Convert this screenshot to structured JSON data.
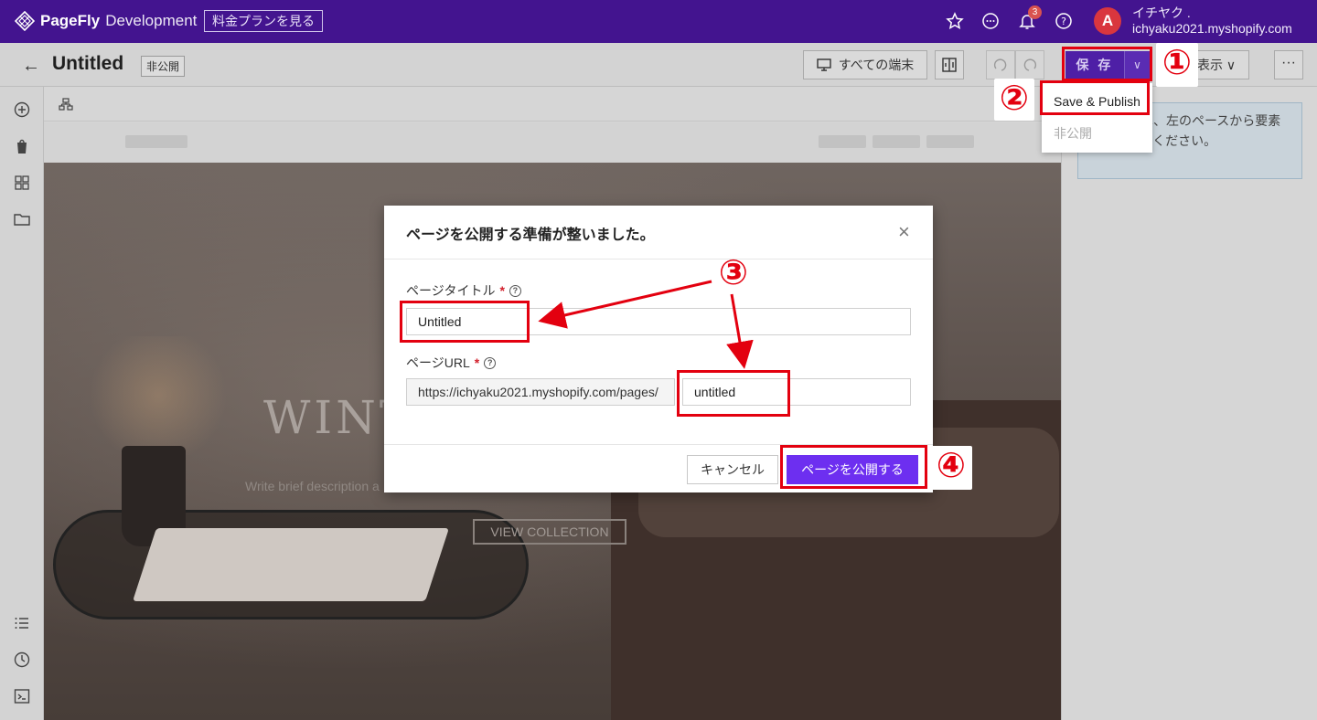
{
  "topbar": {
    "brand_bold": "PageFly",
    "brand_light": "Development",
    "plan_button": "料金プランを見る",
    "notification_count": "3",
    "avatar_letter": "A",
    "user_name": "イチヤク .",
    "user_store": "ichyaku2021.myshopify.com"
  },
  "toolbar": {
    "page_title": "Untitled",
    "status_chip": "非公開",
    "device_button": "すべての端末",
    "save_button": "保 存",
    "view_button": "表示",
    "more_button": "···"
  },
  "dropdown": {
    "items": [
      {
        "label": "Save & Publish",
        "enabled": true
      },
      {
        "label": "非公開",
        "enabled": false
      }
    ]
  },
  "right_panel": {
    "info_text": "を見るには、左のペースから要素を選択してください。"
  },
  "hero": {
    "title": "WINT",
    "description": "Write brief description a",
    "cta": "VIEW COLLECTION"
  },
  "modal": {
    "title": "ページを公開する準備が整いました。",
    "title_label": "ページタイトル",
    "required_mark": "*",
    "title_value": "Untitled",
    "url_label": "ページURL",
    "url_prefix": "https://ichyaku2021.myshopify.com/pages/",
    "url_value": "untitled",
    "cancel_button": "キャンセル",
    "publish_button": "ページを公開する",
    "close_glyph": "×"
  },
  "annotations": {
    "step1": "①",
    "step2": "②",
    "step3": "③",
    "step4": "④"
  },
  "colors": {
    "topbar": "#43148f",
    "publish": "#6d2ff0",
    "annotation_red": "#e3000f"
  },
  "icons": [
    "pagefly-logo-icon",
    "star-icon",
    "chat-icon",
    "bell-icon",
    "help-icon",
    "back-arrow-icon",
    "monitor-icon",
    "compare-icon",
    "undo-icon",
    "redo-icon",
    "chevron-down-icon",
    "add-icon",
    "shopify-icon",
    "grid-icon",
    "folder-icon",
    "list-icon",
    "history-icon",
    "terminal-icon",
    "layers-icon",
    "close-icon"
  ]
}
